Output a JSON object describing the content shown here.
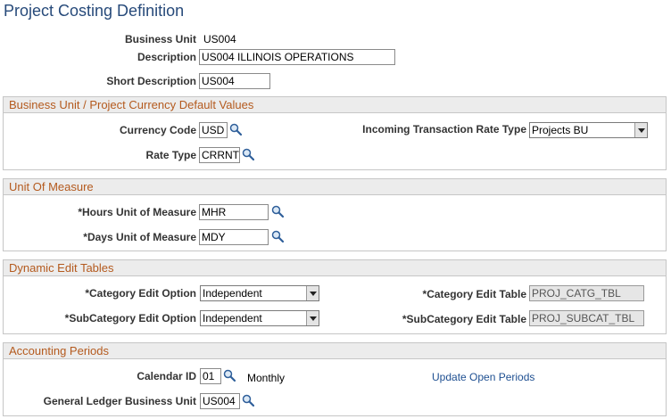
{
  "page": {
    "title": "Project Costing Definition"
  },
  "header": {
    "business_unit_label": "Business Unit",
    "business_unit_value": "US004",
    "description_label": "Description",
    "description_value": "US004 ILLINOIS OPERATIONS",
    "short_description_label": "Short Description",
    "short_description_value": "US004"
  },
  "currency_section": {
    "title": "Business Unit / Project Currency Default Values",
    "currency_code_label": "Currency Code",
    "currency_code_value": "USD",
    "rate_type_label": "Rate Type",
    "rate_type_value": "CRRNT",
    "incoming_rate_type_label": "Incoming Transaction Rate Type",
    "incoming_rate_type_value": "Projects BU"
  },
  "uom_section": {
    "title": "Unit Of Measure",
    "hours_label": "*Hours Unit of Measure",
    "hours_value": "MHR",
    "days_label": "*Days Unit of Measure",
    "days_value": "MDY"
  },
  "dynamic_section": {
    "title": "Dynamic Edit Tables",
    "category_option_label": "*Category Edit Option",
    "category_option_value": "Independent",
    "subcategory_option_label": "*SubCategory Edit Option",
    "subcategory_option_value": "Independent",
    "category_table_label": "*Category Edit Table",
    "category_table_value": "PROJ_CATG_TBL",
    "subcategory_table_label": "*SubCategory Edit Table",
    "subcategory_table_value": "PROJ_SUBCAT_TBL"
  },
  "accounting_section": {
    "title": "Accounting Periods",
    "calendar_id_label": "Calendar ID",
    "calendar_id_value": "01",
    "calendar_desc": "Monthly",
    "update_link": "Update Open Periods",
    "gl_bu_label": "General Ledger Business Unit",
    "gl_bu_value": "US004"
  },
  "icons": {
    "lookup": "magnifier-icon",
    "dropdown": "chevron-down-icon"
  }
}
